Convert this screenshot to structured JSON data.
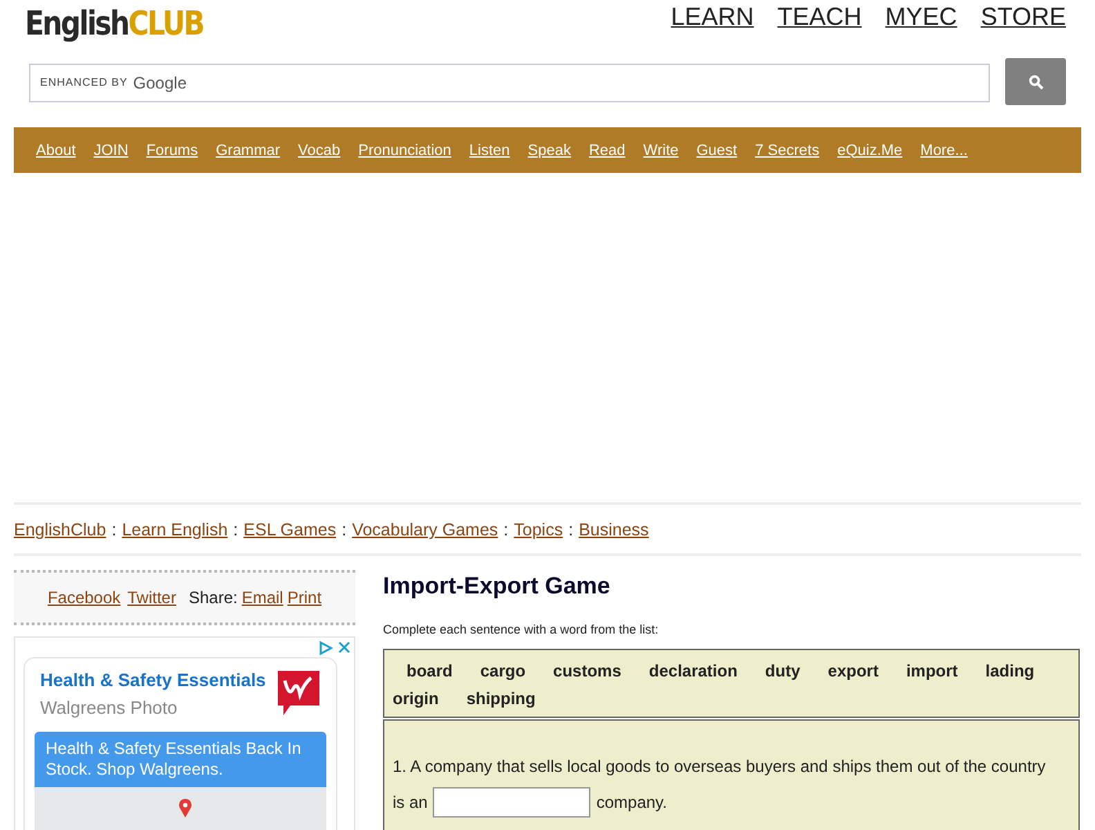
{
  "logo": {
    "part_1": "English",
    "part_2": "CLUB"
  },
  "top_nav": [
    "LEARN",
    "TEACH",
    "MYEC",
    "STORE"
  ],
  "search": {
    "placeholder_prefix": "ENHANCED BY",
    "placeholder_brand": "Google"
  },
  "menu": [
    "About",
    "JOIN",
    "Forums",
    "Grammar",
    "Vocab",
    "Pronunciation",
    "Listen",
    "Speak",
    "Read",
    "Write",
    "Guest",
    "7 Secrets",
    "eQuiz.Me",
    "More..."
  ],
  "breadcrumb": [
    "EnglishClub",
    "Learn English",
    "ESL Games",
    "Vocabulary Games",
    "Topics",
    "Business"
  ],
  "breadcrumb_separator": ":",
  "share": {
    "links": [
      "Facebook",
      "Twitter"
    ],
    "label": "Share:",
    "actions": [
      "Email",
      "Print"
    ]
  },
  "ad": {
    "title": "Health & Safety Essentials",
    "advertiser": "Walgreens Photo",
    "banner": "Health & Safety Essentials Back In Stock. Shop Walgreens."
  },
  "game": {
    "title": "Import-Export Game",
    "instructions": "Complete each sentence with a word from the list:",
    "words": [
      "board",
      "cargo",
      "customs",
      "declaration",
      "duty",
      "export",
      "import",
      "lading",
      "origin",
      "shipping"
    ],
    "questions": [
      {
        "number": "1.",
        "before": "A company that sells local goods to overseas buyers and ships them out of the country",
        "lead_in": "is an",
        "after": "company."
      }
    ]
  }
}
